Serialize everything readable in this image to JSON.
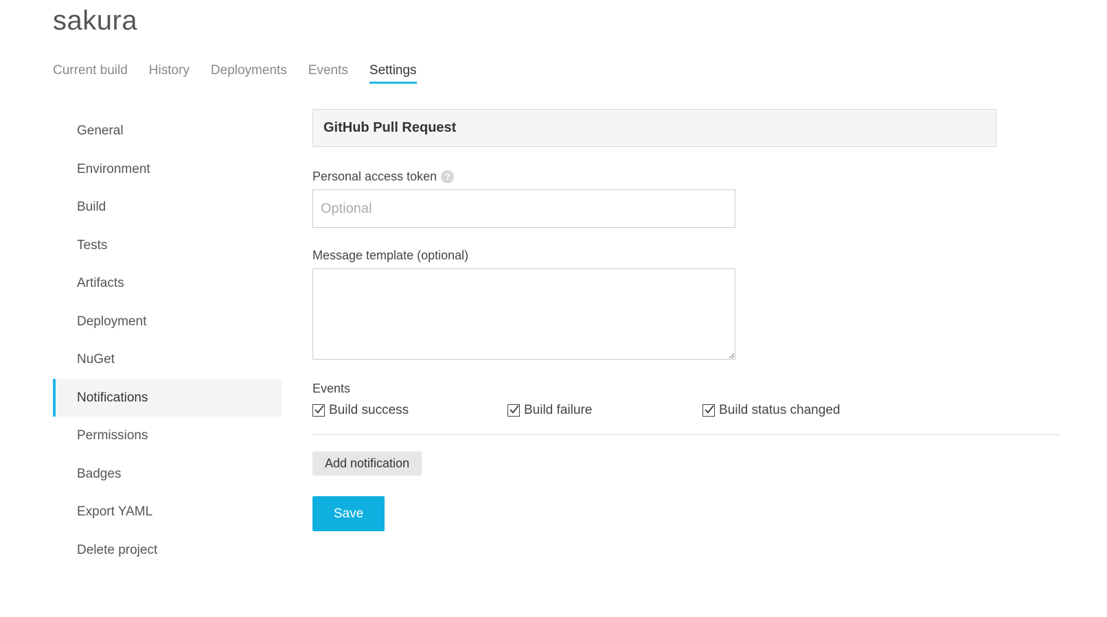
{
  "project": {
    "title": "sakura"
  },
  "tabs": [
    {
      "label": "Current build",
      "active": false
    },
    {
      "label": "History",
      "active": false
    },
    {
      "label": "Deployments",
      "active": false
    },
    {
      "label": "Events",
      "active": false
    },
    {
      "label": "Settings",
      "active": true
    }
  ],
  "sidebar": {
    "items": [
      {
        "label": "General"
      },
      {
        "label": "Environment"
      },
      {
        "label": "Build"
      },
      {
        "label": "Tests"
      },
      {
        "label": "Artifacts"
      },
      {
        "label": "Deployment"
      },
      {
        "label": "NuGet"
      },
      {
        "label": "Notifications",
        "active": true
      },
      {
        "label": "Permissions"
      },
      {
        "label": "Badges"
      },
      {
        "label": "Export YAML"
      },
      {
        "label": "Delete project"
      }
    ]
  },
  "notification": {
    "title": "GitHub Pull Request",
    "token": {
      "label": "Personal access token",
      "help_icon": "question-icon",
      "help_glyph": "?",
      "value": "",
      "placeholder": "Optional"
    },
    "template": {
      "label": "Message template (optional)",
      "value": ""
    },
    "events": {
      "label": "Events",
      "options": [
        {
          "label": "Build success",
          "checked": true
        },
        {
          "label": "Build failure",
          "checked": true
        },
        {
          "label": "Build status changed",
          "checked": true
        }
      ]
    }
  },
  "actions": {
    "add_notification_label": "Add notification",
    "save_label": "Save"
  },
  "colors": {
    "accent": "#1fb6e6",
    "primary_button": "#0fb0e0",
    "active_sidebar_bg": "#f4f4f4"
  }
}
